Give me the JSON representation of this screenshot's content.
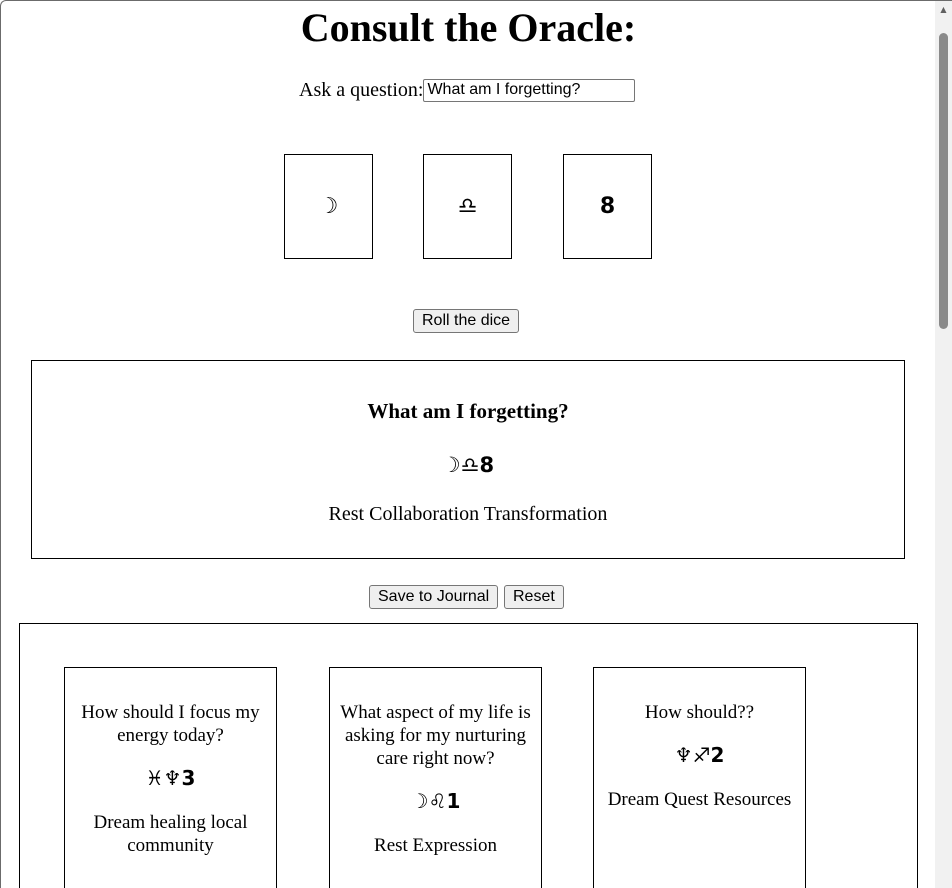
{
  "page": {
    "title": "Consult the Oracle:"
  },
  "ask": {
    "label": "Ask a question:",
    "value": "What am I forgetting?"
  },
  "dice": [
    {
      "symbol": "☽",
      "icon": "moon-icon"
    },
    {
      "symbol": "♎",
      "icon": "libra-icon"
    },
    {
      "symbol": "8",
      "icon": "number-eight"
    }
  ],
  "buttons": {
    "roll": "Roll the dice",
    "save": "Save to Journal",
    "reset": "Reset"
  },
  "result": {
    "question": "What am I forgetting?",
    "symbols": "☽♎8",
    "words": "Rest Collaboration Transformation"
  },
  "journal": [
    {
      "question": "How should I focus my energy today?",
      "symbols": "♓♆3",
      "words": "Dream healing local community"
    },
    {
      "question": "What aspect of my life is asking for my nurturing care right now?",
      "symbols": "☽♌1",
      "words": "Rest Expression"
    },
    {
      "question": "How should??",
      "symbols": "♆♐2",
      "words": "Dream Quest Resources"
    }
  ],
  "colors": {
    "border": "#000000",
    "button_bg": "#efefef",
    "scrollbar_thumb": "#8a8a8a"
  }
}
